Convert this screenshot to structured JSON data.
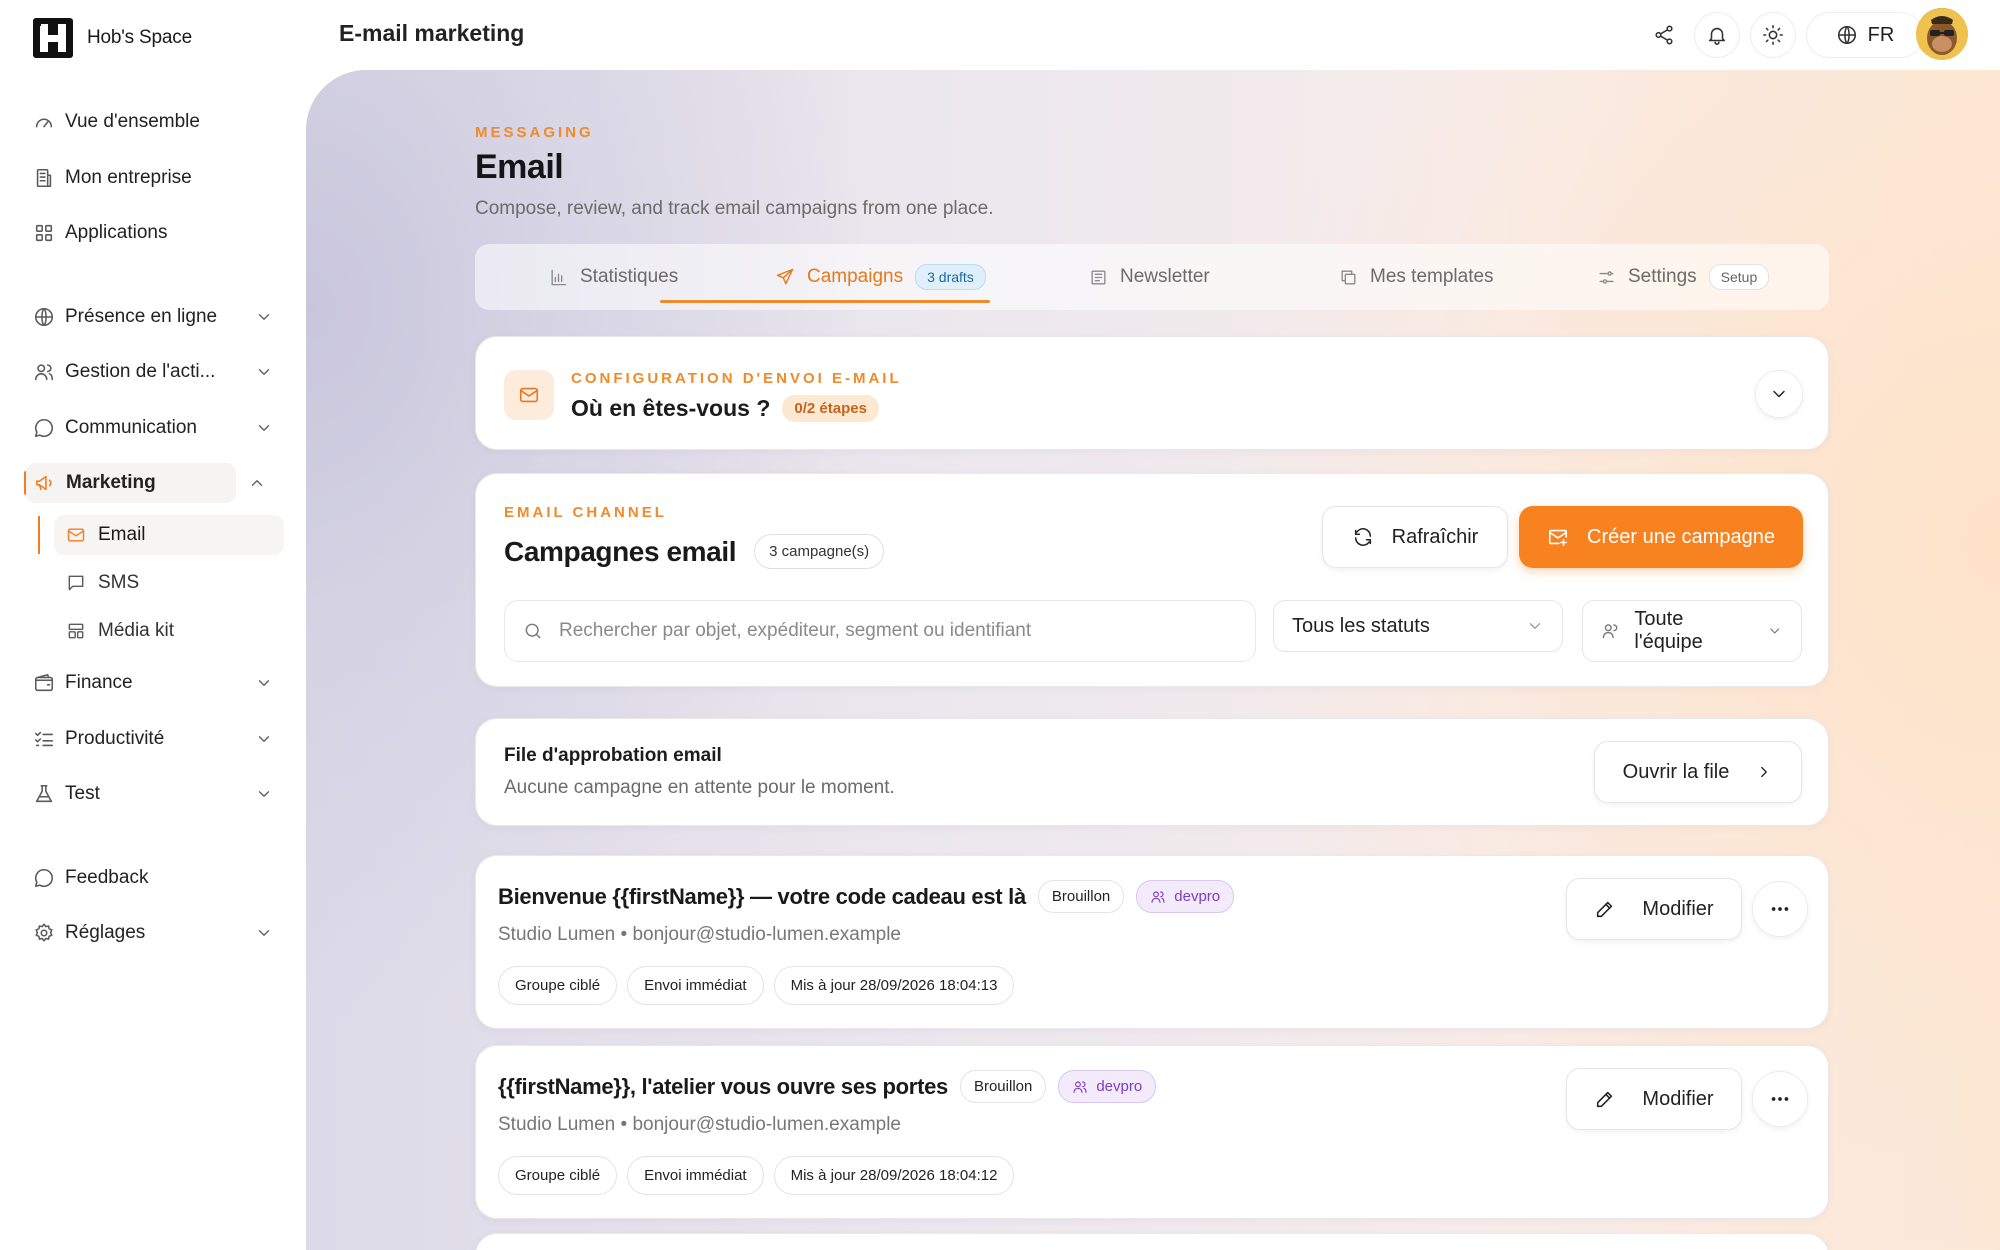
{
  "brand": {
    "name": "Hob's Space"
  },
  "sidebar": {
    "items": [
      {
        "label": "Vue d'ensemble",
        "icon": "gauge-icon"
      },
      {
        "label": "Mon entreprise",
        "icon": "building-icon"
      },
      {
        "label": "Applications",
        "icon": "grid-icon"
      },
      {
        "label": "Présence en ligne",
        "icon": "globe-icon"
      },
      {
        "label": "Gestion de l'acti...",
        "icon": "users-icon"
      },
      {
        "label": "Communication",
        "icon": "chat-icon"
      },
      {
        "label": "Marketing",
        "icon": "megaphone-icon"
      },
      {
        "label": "Finance",
        "icon": "wallet-icon"
      },
      {
        "label": "Productivité",
        "icon": "checklist-icon"
      },
      {
        "label": "Test",
        "icon": "flask-icon"
      },
      {
        "label": "Feedback",
        "icon": "feedback-icon"
      },
      {
        "label": "Réglages",
        "icon": "gear-icon"
      }
    ],
    "marketing_sub": [
      {
        "label": "Email",
        "icon": "mail-icon"
      },
      {
        "label": "SMS",
        "icon": "sms-icon"
      },
      {
        "label": "Média kit",
        "icon": "media-kit-icon"
      }
    ]
  },
  "topbar": {
    "title": "E-mail marketing",
    "lang": "FR"
  },
  "header": {
    "eyebrow": "MESSAGING",
    "title": "Email",
    "description": "Compose, review, and track email campaigns from one place."
  },
  "tabs": [
    {
      "label": "Statistiques"
    },
    {
      "label": "Campaigns",
      "badge": "3 drafts"
    },
    {
      "label": "Newsletter"
    },
    {
      "label": "Mes templates"
    },
    {
      "label": "Settings",
      "badge": "Setup"
    }
  ],
  "config": {
    "eyebrow": "CONFIGURATION D'ENVOI E-MAIL",
    "title": "Où en êtes-vous ?",
    "progress": "0/2 étapes"
  },
  "campaigns": {
    "eyebrow": "EMAIL CHANNEL",
    "title": "Campagnes email",
    "count": "3 campagne(s)",
    "refresh_label": "Rafraîchir",
    "create_label": "Créer une campagne",
    "search_placeholder": "Rechercher par objet, expéditeur, segment ou identifiant",
    "status_filter": "Tous les statuts",
    "team_filter": "Toute l'équipe"
  },
  "approval": {
    "title": "File d'approbation email",
    "description": "Aucune campagne en attente pour le moment.",
    "button": "Ouvrir la file"
  },
  "items": [
    {
      "title": "Bienvenue {{firstName}} — votre code cadeau est là",
      "status": "Brouillon",
      "segment": "devpro",
      "sender": "Studio Lumen • bonjour@studio-lumen.example",
      "meta": [
        "Groupe ciblé",
        "Envoi immédiat",
        "Mis à jour 28/09/2026 18:04:13"
      ],
      "edit_label": "Modifier"
    },
    {
      "title": "{{firstName}}, l'atelier vous ouvre ses portes",
      "status": "Brouillon",
      "segment": "devpro",
      "sender": "Studio Lumen • bonjour@studio-lumen.example",
      "meta": [
        "Groupe ciblé",
        "Envoi immédiat",
        "Mis à jour 28/09/2026 18:04:12"
      ],
      "edit_label": "Modifier"
    }
  ],
  "colors": {
    "accent": "#f7821f",
    "accent_text": "#e8791a",
    "segment_purple": "#7a3fc4",
    "draft_badge_blue": "#1b6aa0"
  }
}
